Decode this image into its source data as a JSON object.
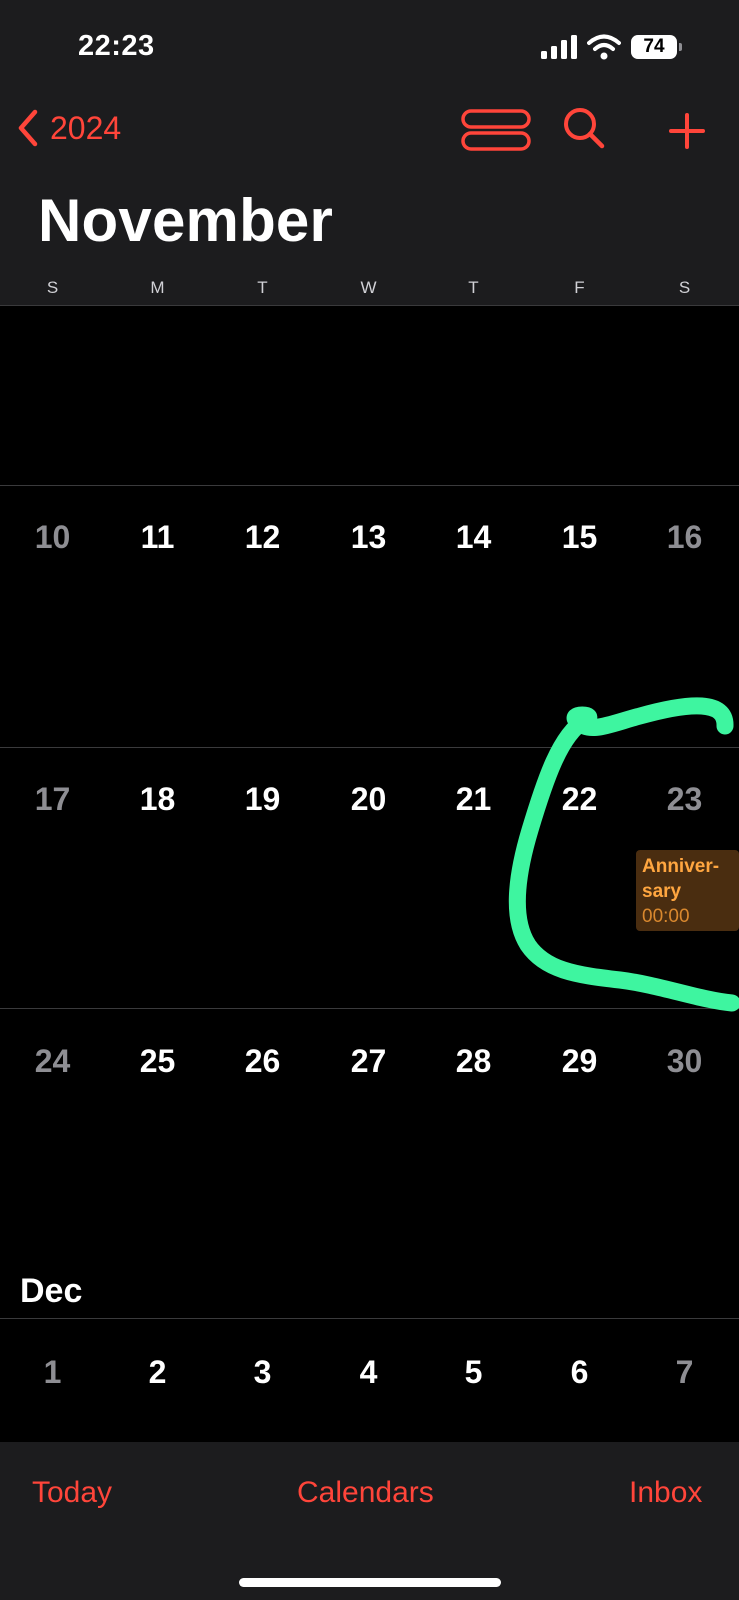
{
  "status_bar": {
    "time": "22:23",
    "battery": "74"
  },
  "nav": {
    "back_label": "2024"
  },
  "calendar": {
    "month_title": "November",
    "weekdays": [
      "S",
      "M",
      "T",
      "W",
      "T",
      "F",
      "S"
    ],
    "weeks": [
      [
        "10",
        "11",
        "12",
        "13",
        "14",
        "15",
        "16"
      ],
      [
        "17",
        "18",
        "19",
        "20",
        "21",
        "22",
        "23"
      ],
      [
        "24",
        "25",
        "26",
        "27",
        "28",
        "29",
        "30"
      ]
    ],
    "next_month_label": "Dec",
    "next_month_week": [
      "1",
      "2",
      "3",
      "4",
      "5",
      "6",
      "7"
    ],
    "event": {
      "title_line1": "Anniver-",
      "title_line2": "sary",
      "time": "00:00",
      "color": "#ffa640"
    }
  },
  "tabbar": {
    "today": "Today",
    "calendars": "Calendars",
    "inbox": "Inbox"
  },
  "colors": {
    "accent": "#ff453a",
    "annotation": "#3ef5a0"
  },
  "icons": [
    "cellular-signal-icon",
    "wifi-icon",
    "battery-icon",
    "chevron-left-icon",
    "list-view-icon",
    "search-icon",
    "plus-icon"
  ]
}
